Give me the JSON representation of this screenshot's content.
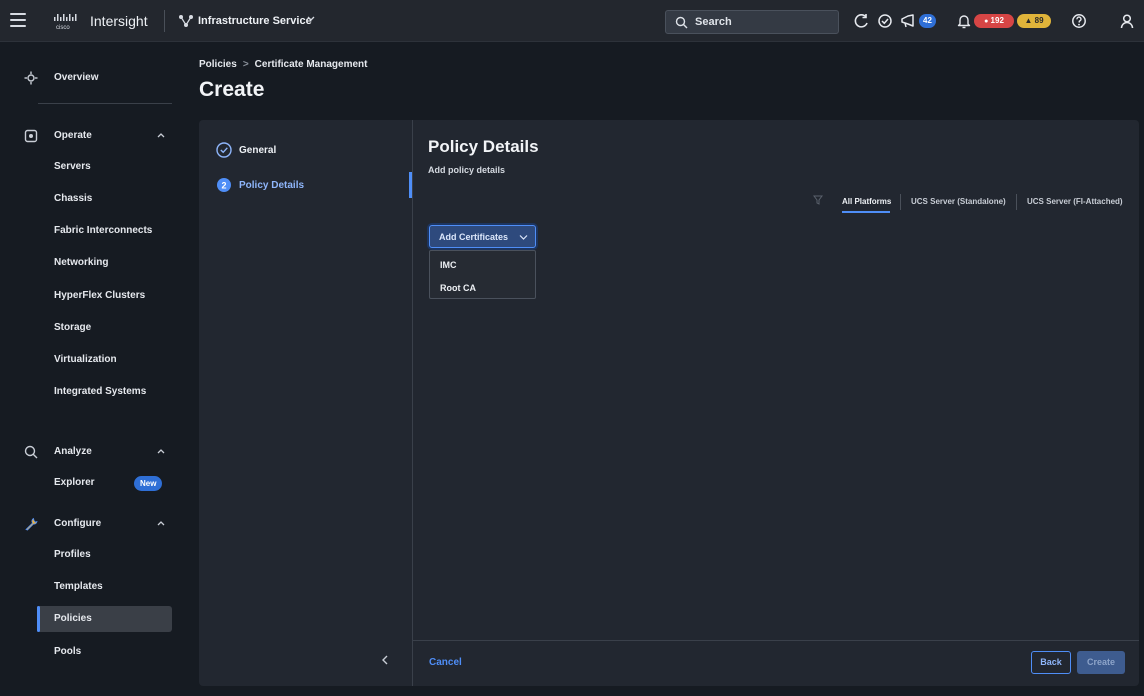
{
  "topbar": {
    "brand": "Intersight",
    "service": "Infrastructure Service",
    "search_label": "Search",
    "announcements_count": "42",
    "critical_count": "192",
    "warning_count": "89"
  },
  "sidebar": {
    "overview": "Overview",
    "operate": {
      "label": "Operate",
      "items": [
        "Servers",
        "Chassis",
        "Fabric Interconnects",
        "Networking",
        "HyperFlex Clusters",
        "Storage",
        "Virtualization",
        "Integrated Systems"
      ]
    },
    "analyze": {
      "label": "Analyze",
      "explorer": "Explorer",
      "new_badge": "New"
    },
    "configure": {
      "label": "Configure",
      "items": [
        "Profiles",
        "Templates",
        "Policies",
        "Pools"
      ],
      "active": "Policies"
    }
  },
  "header": {
    "breadcrumb": [
      "Policies",
      "Certificate Management"
    ],
    "title": "Create"
  },
  "wizard": {
    "steps": [
      {
        "label": "General",
        "state": "complete"
      },
      {
        "number": "2",
        "label": "Policy Details",
        "state": "active"
      }
    ],
    "panel_title": "Policy Details",
    "panel_subtitle": "Add policy details",
    "platform_tabs": [
      "All Platforms",
      "UCS Server (Standalone)",
      "UCS Server (FI-Attached)"
    ],
    "active_platform": "All Platforms",
    "add_button": "Add Certificates",
    "dropdown_items": [
      "IMC",
      "Root CA"
    ],
    "cancel": "Cancel",
    "back": "Back",
    "create": "Create"
  },
  "colors": {
    "accent": "#4f8ef7",
    "critical": "#d64545",
    "warning": "#e0b43a"
  }
}
